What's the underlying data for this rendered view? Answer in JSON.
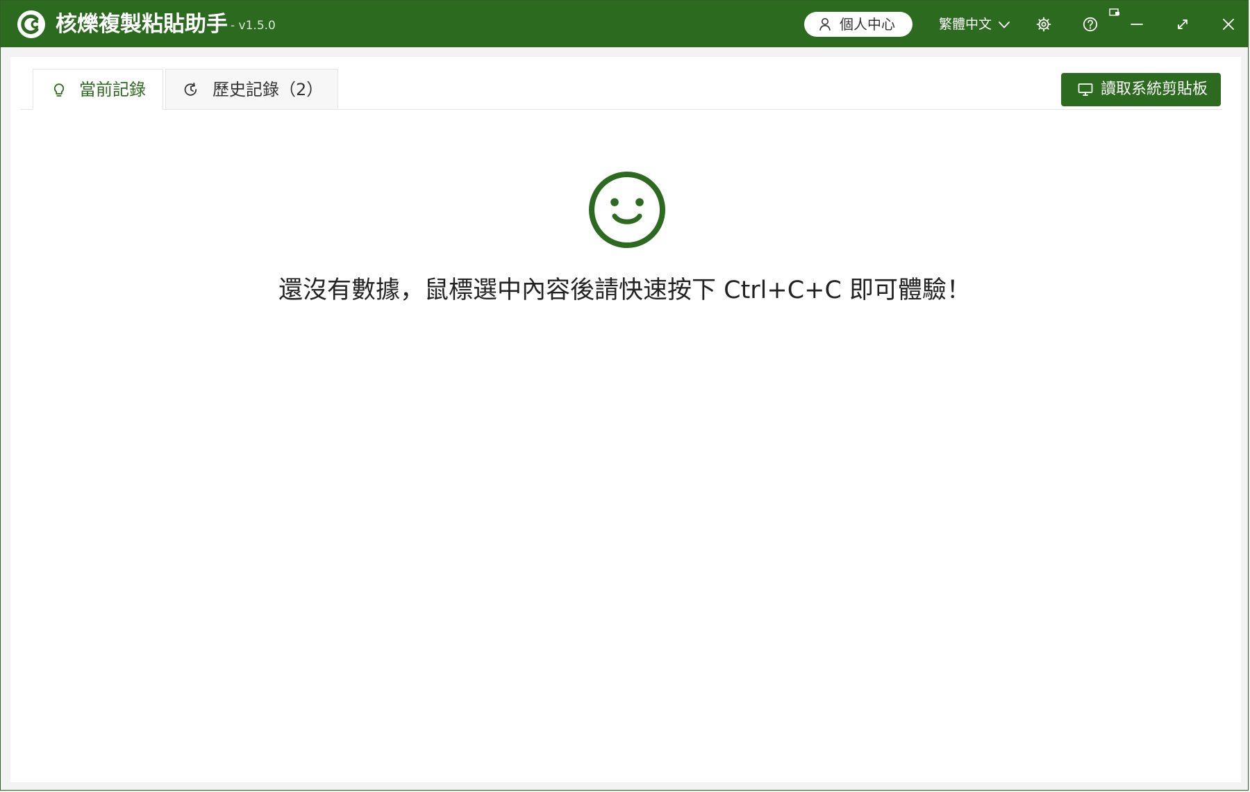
{
  "app": {
    "title": "核爍複製粘貼助手",
    "version": "- v1.5.0"
  },
  "titlebar": {
    "personal_center": "個人中心",
    "language": "繁體中文",
    "icons": {
      "user": "user-icon",
      "language_dropdown": "chevron-down-icon",
      "settings": "gear-icon",
      "help": "help-icon",
      "small_badge": "window-badge-icon",
      "minimize": "minimize-icon",
      "maximize": "maximize-icon",
      "close": "close-icon"
    }
  },
  "tabs": [
    {
      "label": "當前記錄",
      "icon": "lightbulb-icon",
      "active": true
    },
    {
      "label": "歷史記錄（2）",
      "icon": "history-icon",
      "active": false
    }
  ],
  "toolbar": {
    "read_clipboard": "讀取系統剪貼板",
    "read_clipboard_icon": "monitor-icon"
  },
  "empty_state": {
    "icon": "smile-icon",
    "message": "還沒有數據，鼠標選中內容後請快速按下 Ctrl+C+C 即可體驗！"
  },
  "colors": {
    "brand": "#2c6a1f",
    "title_text": "#ffffff",
    "content_background": "#ffffff",
    "window_background": "#f3f3f3"
  }
}
